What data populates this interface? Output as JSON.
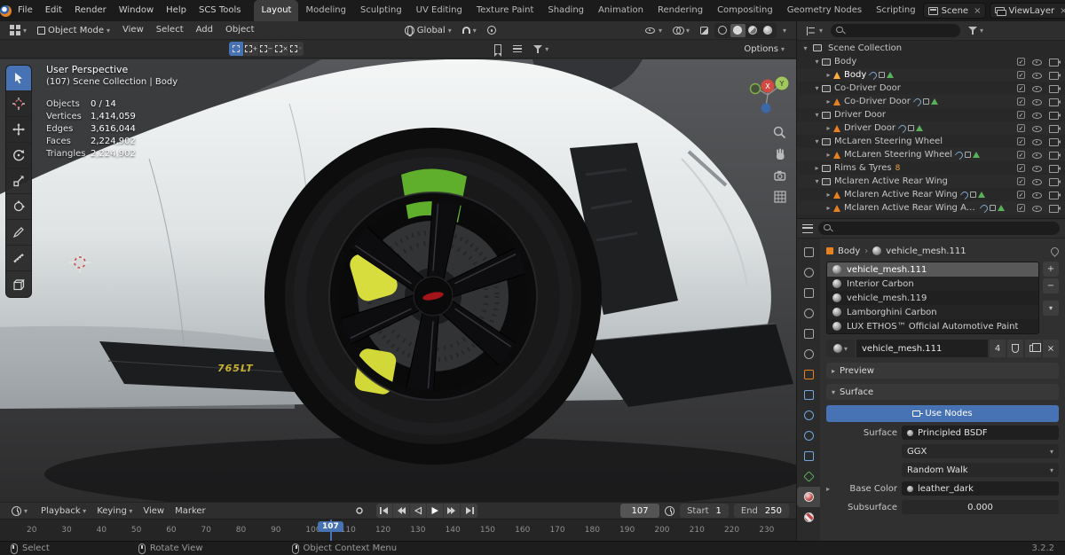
{
  "topbar": {
    "menus": [
      "File",
      "Edit",
      "Render",
      "Window",
      "Help",
      "SCS Tools"
    ],
    "workspaces": [
      "Layout",
      "Modeling",
      "Sculpting",
      "UV Editing",
      "Texture Paint",
      "Shading",
      "Animation",
      "Rendering",
      "Compositing",
      "Geometry Nodes",
      "Scripting"
    ],
    "active_workspace": "Layout",
    "scene": "Scene",
    "viewlayer": "ViewLayer"
  },
  "viewport_header": {
    "mode": "Object Mode",
    "menus": [
      "View",
      "Select",
      "Add",
      "Object"
    ],
    "orientation": "Global",
    "options": "Options"
  },
  "viewport": {
    "perspective_label": "User Perspective",
    "collection_label": "(107) Scene Collection | Body",
    "stats": [
      {
        "label": "Objects",
        "value": "0 / 14"
      },
      {
        "label": "Vertices",
        "value": "1,414,059"
      },
      {
        "label": "Edges",
        "value": "3,616,044"
      },
      {
        "label": "Faces",
        "value": "2,224,902"
      },
      {
        "label": "Triangles",
        "value": "2,224,902"
      }
    ],
    "car_badge": "765LT",
    "axis_x": "X",
    "axis_y": "Y"
  },
  "outliner": {
    "root_label": "Scene Collection",
    "rows": [
      {
        "label": "Body",
        "level": 1,
        "col": true,
        "arrow": "▾"
      },
      {
        "label": "Body",
        "level": 2,
        "obj": true,
        "arrow": "▸",
        "active": true,
        "extras": true
      },
      {
        "label": "Co-Driver Door",
        "level": 1,
        "col": true,
        "arrow": "▾"
      },
      {
        "label": "Co-Driver Door",
        "level": 2,
        "obj": true,
        "arrow": "▸",
        "extras": true
      },
      {
        "label": "Driver Door",
        "level": 1,
        "col": true,
        "arrow": "▾"
      },
      {
        "label": "Driver Door",
        "level": 2,
        "obj": true,
        "arrow": "▸",
        "extras": true
      },
      {
        "label": "McLaren Steering Wheel",
        "level": 1,
        "col": true,
        "arrow": "▾"
      },
      {
        "label": "McLaren Steering Wheel",
        "level": 2,
        "obj": true,
        "arrow": "▸",
        "extras": true
      },
      {
        "label": "Rims & Tyres",
        "level": 1,
        "col": true,
        "arrow": "▸",
        "badge": "8"
      },
      {
        "label": "Mclaren Active Rear Wing",
        "level": 1,
        "col": true,
        "arrow": "▾"
      },
      {
        "label": "Mclaren Active Rear Wing",
        "level": 2,
        "obj": true,
        "arrow": "▸",
        "extras": true
      },
      {
        "label": "Mclaren Active Rear Wing Actuators",
        "level": 2,
        "obj": true,
        "arrow": "▸",
        "extras": true
      }
    ]
  },
  "properties": {
    "breadcrumb_object": "Body",
    "breadcrumb_data": "vehicle_mesh.111",
    "slots": [
      {
        "name": "vehicle_mesh.111",
        "selected": true
      },
      {
        "name": "Interior Carbon"
      },
      {
        "name": "vehicle_mesh.119"
      },
      {
        "name": "Lamborghini Carbon"
      },
      {
        "name": "LUX ETHOS™ Official Automotive Paint"
      }
    ],
    "material_name": "vehicle_mesh.111",
    "material_users": "4",
    "preview_label": "Preview",
    "surface_label": "Surface",
    "use_nodes": "Use Nodes",
    "surface_field_label": "Surface",
    "surface_value": "Principled BSDF",
    "distribution": "GGX",
    "subsurface_method": "Random Walk",
    "base_color_label": "Base Color",
    "base_color_value": "leather_dark",
    "subsurface_label": "Subsurface",
    "subsurface_value": "0.000",
    "tabs": [
      {
        "name": "tool-tab",
        "cls": "grey"
      },
      {
        "name": "render-tab",
        "cls": "greyr"
      },
      {
        "name": "output-tab",
        "cls": "grey"
      },
      {
        "name": "view-layer-tab",
        "cls": "greyr"
      },
      {
        "name": "scene-tab",
        "cls": "grey"
      },
      {
        "name": "world-tab",
        "cls": "greyr"
      },
      {
        "name": "object-tab",
        "cls": "orange"
      },
      {
        "name": "modifiers-tab",
        "cls": "blue"
      },
      {
        "name": "particles-tab",
        "cls": "bluer"
      },
      {
        "name": "physics-tab",
        "cls": "bluer"
      },
      {
        "name": "constraints-tab",
        "cls": "blue"
      },
      {
        "name": "object-data-tab",
        "cls": "green"
      },
      {
        "name": "material-tab",
        "cls": "red",
        "active": true
      },
      {
        "name": "texture-tab",
        "cls": "redr"
      }
    ]
  },
  "timeline": {
    "menus": [
      "Playback",
      "Keying",
      "View",
      "Marker"
    ],
    "current_frame": "107",
    "start_label": "Start",
    "start_value": "1",
    "end_label": "End",
    "end_value": "250",
    "ticks": [
      "20",
      "30",
      "40",
      "50",
      "60",
      "70",
      "80",
      "90",
      "100",
      "110",
      "120",
      "130",
      "140",
      "150",
      "160",
      "170",
      "180",
      "190",
      "200",
      "210",
      "220",
      "230"
    ]
  },
  "statusbar": {
    "items": [
      {
        "label": "Select",
        "btn": "lmb"
      },
      {
        "label": "Rotate View",
        "btn": "mmb"
      },
      {
        "label": "Object Context Menu",
        "btn": "rmb"
      }
    ],
    "version": "3.2.2"
  }
}
